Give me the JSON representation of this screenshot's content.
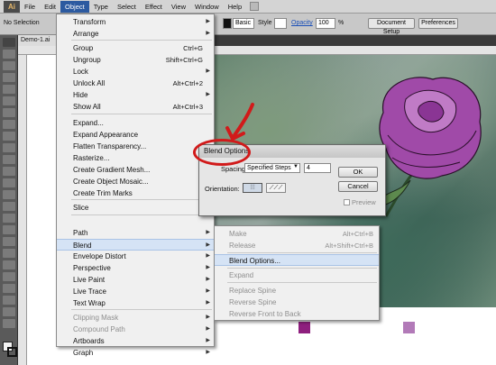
{
  "menubar": {
    "logo": "Ai",
    "items": [
      "File",
      "Edit",
      "Object",
      "Type",
      "Select",
      "Effect",
      "View",
      "Window",
      "Help"
    ]
  },
  "controlbar": {
    "selection": "No Selection",
    "basic": "Basic",
    "style": "Style",
    "opacity_label": "Opacity",
    "opacity_value": "100",
    "percent": "%",
    "doc_setup": "Document Setup",
    "preferences": "Preferences"
  },
  "document": {
    "tab": "Demo-1.ai @"
  },
  "object_menu": {
    "items": [
      {
        "label": "Transform",
        "shortcut": "",
        "submenu": true,
        "disabled": false
      },
      {
        "label": "Arrange",
        "shortcut": "",
        "submenu": true,
        "disabled": false
      },
      {
        "label": "Group",
        "shortcut": "Ctrl+G",
        "submenu": false,
        "disabled": false
      },
      {
        "label": "Ungroup",
        "shortcut": "Shift+Ctrl+G",
        "submenu": false,
        "disabled": false
      },
      {
        "label": "Lock",
        "shortcut": "",
        "submenu": true,
        "disabled": false
      },
      {
        "label": "Unlock All",
        "shortcut": "Alt+Ctrl+2",
        "submenu": false,
        "disabled": false
      },
      {
        "label": "Hide",
        "shortcut": "",
        "submenu": true,
        "disabled": false
      },
      {
        "label": "Show All",
        "shortcut": "Alt+Ctrl+3",
        "submenu": false,
        "disabled": false
      },
      {
        "label": "Expand...",
        "shortcut": "",
        "submenu": false,
        "disabled": false
      },
      {
        "label": "Expand Appearance",
        "shortcut": "",
        "submenu": false,
        "disabled": false
      },
      {
        "label": "Flatten Transparency...",
        "shortcut": "",
        "submenu": false,
        "disabled": false
      },
      {
        "label": "Rasterize...",
        "shortcut": "",
        "submenu": false,
        "disabled": false
      },
      {
        "label": "Create Gradient Mesh...",
        "shortcut": "",
        "submenu": false,
        "disabled": false
      },
      {
        "label": "Create Object Mosaic...",
        "shortcut": "",
        "submenu": false,
        "disabled": false
      },
      {
        "label": "Create Trim Marks",
        "shortcut": "",
        "submenu": false,
        "disabled": false
      },
      {
        "label": "Slice",
        "shortcut": "",
        "submenu": true,
        "disabled": false
      },
      {
        "label": "Path",
        "shortcut": "",
        "submenu": true,
        "disabled": false
      },
      {
        "label": "Blend",
        "shortcut": "",
        "submenu": true,
        "disabled": false
      },
      {
        "label": "Envelope Distort",
        "shortcut": "",
        "submenu": true,
        "disabled": false
      },
      {
        "label": "Perspective",
        "shortcut": "",
        "submenu": true,
        "disabled": false
      },
      {
        "label": "Live Paint",
        "shortcut": "",
        "submenu": true,
        "disabled": false
      },
      {
        "label": "Live Trace",
        "shortcut": "",
        "submenu": true,
        "disabled": false
      },
      {
        "label": "Text Wrap",
        "shortcut": "",
        "submenu": true,
        "disabled": false
      },
      {
        "label": "Clipping Mask",
        "shortcut": "",
        "submenu": true,
        "disabled": true
      },
      {
        "label": "Compound Path",
        "shortcut": "",
        "submenu": true,
        "disabled": true
      },
      {
        "label": "Artboards",
        "shortcut": "",
        "submenu": true,
        "disabled": false
      },
      {
        "label": "Graph",
        "shortcut": "",
        "submenu": true,
        "disabled": false
      }
    ]
  },
  "blend_submenu": {
    "items": [
      {
        "label": "Make",
        "shortcut": "Alt+Ctrl+B",
        "disabled": true
      },
      {
        "label": "Release",
        "shortcut": "Alt+Shift+Ctrl+B",
        "disabled": true
      },
      {
        "label": "Blend Options...",
        "shortcut": "",
        "disabled": false
      },
      {
        "label": "Expand",
        "shortcut": "",
        "disabled": true
      },
      {
        "label": "Replace Spine",
        "shortcut": "",
        "disabled": true
      },
      {
        "label": "Reverse Spine",
        "shortcut": "",
        "disabled": true
      },
      {
        "label": "Reverse Front to Back",
        "shortcut": "",
        "disabled": true
      }
    ]
  },
  "blend_dialog": {
    "title": "Blend Options",
    "spacing_label": "Spacing:",
    "spacing_value": "Specified Steps",
    "steps_value": "4",
    "orientation_label": "Orientation:",
    "ok": "OK",
    "cancel": "Cancel",
    "preview": "Preview"
  },
  "colors": {
    "menu_highlight": "#d5e3f5",
    "active_menu": "#2c5aa0",
    "annotation_red": "#d11a1a",
    "blend_square_1": "#8e1f7e",
    "blend_square_2": "#b27ab8"
  }
}
